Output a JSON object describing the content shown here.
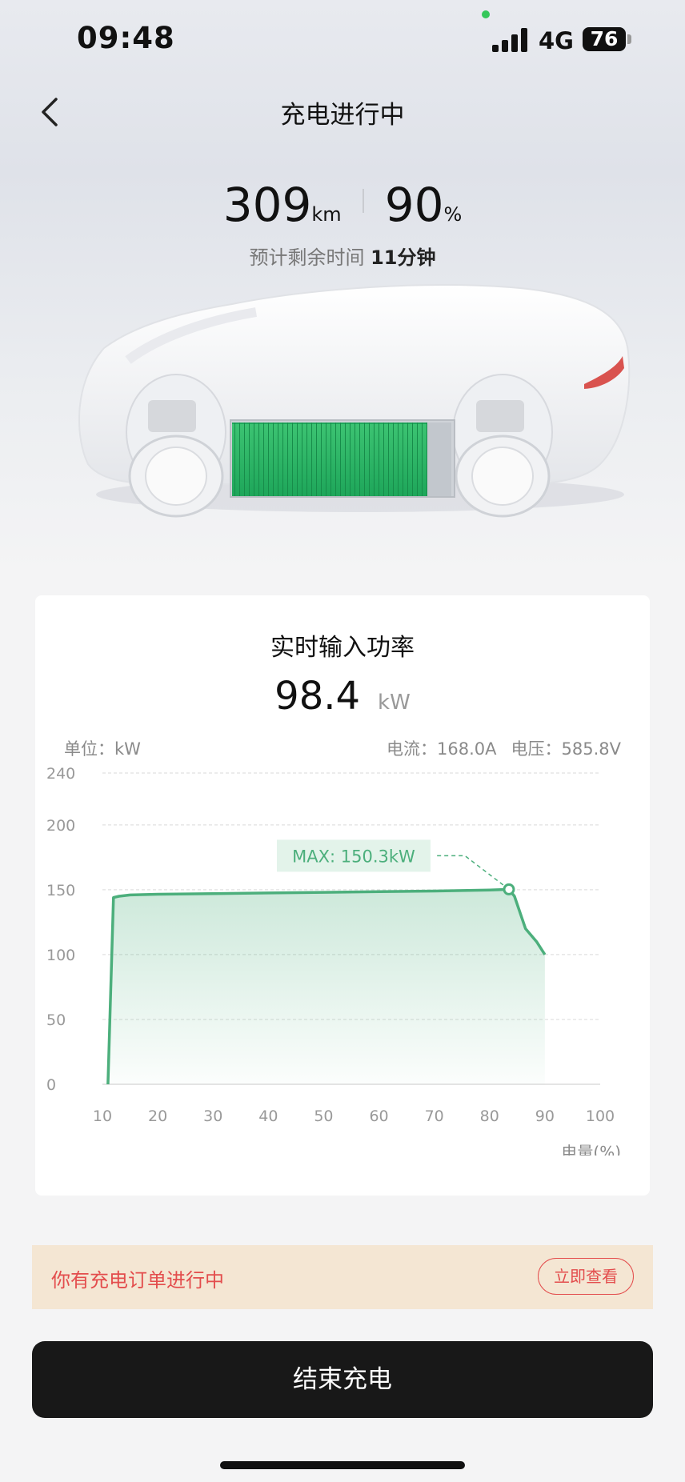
{
  "status_bar": {
    "time": "09:48",
    "network": "4G",
    "battery": "76"
  },
  "header": {
    "title": "充电进行中"
  },
  "summary": {
    "range_value": "309",
    "range_unit": "km",
    "soc_value": "90",
    "soc_unit": "%",
    "eta_label": "预计剩余时间",
    "eta_value": "11分钟"
  },
  "power_card": {
    "title": "实时输入功率",
    "power_value": "98.4",
    "power_unit": "kW",
    "unit_label": "单位：kW",
    "current": "电流：168.0A",
    "voltage": "电压：585.8V"
  },
  "chart_data": {
    "type": "area",
    "xlabel": "电量(%)",
    "ylabel": "",
    "xlim": [
      10,
      100
    ],
    "ylim": [
      0,
      240
    ],
    "x_ticks": [
      10,
      20,
      30,
      40,
      50,
      60,
      70,
      80,
      90,
      100
    ],
    "y_ticks": [
      0,
      50,
      100,
      150,
      200,
      240
    ],
    "grid": true,
    "series": [
      {
        "x": [
          11,
          12,
          13,
          15,
          20,
          30,
          40,
          50,
          60,
          70,
          80,
          83.5,
          84.5,
          86.5,
          88.5,
          90
        ],
        "y": [
          0,
          144,
          145,
          146,
          146.5,
          147,
          147.5,
          148,
          148.5,
          149,
          149.8,
          150.3,
          145,
          120,
          110,
          100
        ]
      }
    ],
    "annotation": {
      "text": "MAX: 150.3kW",
      "x": 83.5,
      "y": 150.3
    },
    "color": "#4caf7c"
  },
  "order_banner": {
    "text": "你有充电订单进行中",
    "button": "立即查看"
  },
  "actions": {
    "end_label": "结束充电"
  }
}
